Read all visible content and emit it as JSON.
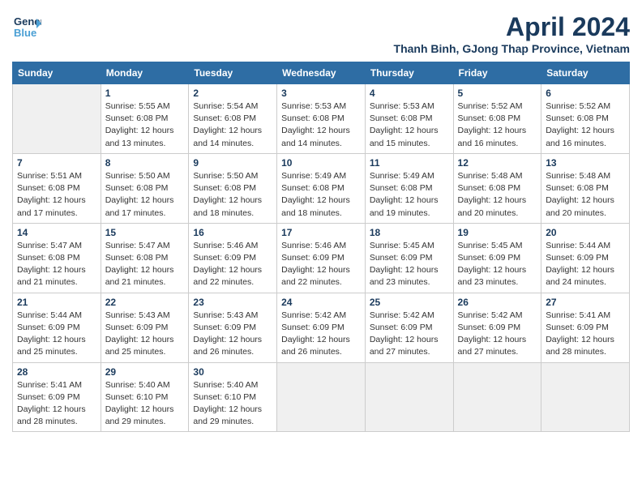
{
  "header": {
    "logo_line1": "General",
    "logo_line2": "Blue",
    "title": "April 2024",
    "subtitle": "Thanh Binh, GJong Thap Province, Vietnam"
  },
  "weekdays": [
    "Sunday",
    "Monday",
    "Tuesday",
    "Wednesday",
    "Thursday",
    "Friday",
    "Saturday"
  ],
  "weeks": [
    [
      {
        "day": "",
        "empty": true
      },
      {
        "day": "1",
        "sunrise": "5:55 AM",
        "sunset": "6:08 PM",
        "daylight": "12 hours and 13 minutes."
      },
      {
        "day": "2",
        "sunrise": "5:54 AM",
        "sunset": "6:08 PM",
        "daylight": "12 hours and 14 minutes."
      },
      {
        "day": "3",
        "sunrise": "5:53 AM",
        "sunset": "6:08 PM",
        "daylight": "12 hours and 14 minutes."
      },
      {
        "day": "4",
        "sunrise": "5:53 AM",
        "sunset": "6:08 PM",
        "daylight": "12 hours and 15 minutes."
      },
      {
        "day": "5",
        "sunrise": "5:52 AM",
        "sunset": "6:08 PM",
        "daylight": "12 hours and 16 minutes."
      },
      {
        "day": "6",
        "sunrise": "5:52 AM",
        "sunset": "6:08 PM",
        "daylight": "12 hours and 16 minutes."
      }
    ],
    [
      {
        "day": "7",
        "sunrise": "5:51 AM",
        "sunset": "6:08 PM",
        "daylight": "12 hours and 17 minutes."
      },
      {
        "day": "8",
        "sunrise": "5:50 AM",
        "sunset": "6:08 PM",
        "daylight": "12 hours and 17 minutes."
      },
      {
        "day": "9",
        "sunrise": "5:50 AM",
        "sunset": "6:08 PM",
        "daylight": "12 hours and 18 minutes."
      },
      {
        "day": "10",
        "sunrise": "5:49 AM",
        "sunset": "6:08 PM",
        "daylight": "12 hours and 18 minutes."
      },
      {
        "day": "11",
        "sunrise": "5:49 AM",
        "sunset": "6:08 PM",
        "daylight": "12 hours and 19 minutes."
      },
      {
        "day": "12",
        "sunrise": "5:48 AM",
        "sunset": "6:08 PM",
        "daylight": "12 hours and 20 minutes."
      },
      {
        "day": "13",
        "sunrise": "5:48 AM",
        "sunset": "6:08 PM",
        "daylight": "12 hours and 20 minutes."
      }
    ],
    [
      {
        "day": "14",
        "sunrise": "5:47 AM",
        "sunset": "6:08 PM",
        "daylight": "12 hours and 21 minutes."
      },
      {
        "day": "15",
        "sunrise": "5:47 AM",
        "sunset": "6:08 PM",
        "daylight": "12 hours and 21 minutes."
      },
      {
        "day": "16",
        "sunrise": "5:46 AM",
        "sunset": "6:09 PM",
        "daylight": "12 hours and 22 minutes."
      },
      {
        "day": "17",
        "sunrise": "5:46 AM",
        "sunset": "6:09 PM",
        "daylight": "12 hours and 22 minutes."
      },
      {
        "day": "18",
        "sunrise": "5:45 AM",
        "sunset": "6:09 PM",
        "daylight": "12 hours and 23 minutes."
      },
      {
        "day": "19",
        "sunrise": "5:45 AM",
        "sunset": "6:09 PM",
        "daylight": "12 hours and 23 minutes."
      },
      {
        "day": "20",
        "sunrise": "5:44 AM",
        "sunset": "6:09 PM",
        "daylight": "12 hours and 24 minutes."
      }
    ],
    [
      {
        "day": "21",
        "sunrise": "5:44 AM",
        "sunset": "6:09 PM",
        "daylight": "12 hours and 25 minutes."
      },
      {
        "day": "22",
        "sunrise": "5:43 AM",
        "sunset": "6:09 PM",
        "daylight": "12 hours and 25 minutes."
      },
      {
        "day": "23",
        "sunrise": "5:43 AM",
        "sunset": "6:09 PM",
        "daylight": "12 hours and 26 minutes."
      },
      {
        "day": "24",
        "sunrise": "5:42 AM",
        "sunset": "6:09 PM",
        "daylight": "12 hours and 26 minutes."
      },
      {
        "day": "25",
        "sunrise": "5:42 AM",
        "sunset": "6:09 PM",
        "daylight": "12 hours and 27 minutes."
      },
      {
        "day": "26",
        "sunrise": "5:42 AM",
        "sunset": "6:09 PM",
        "daylight": "12 hours and 27 minutes."
      },
      {
        "day": "27",
        "sunrise": "5:41 AM",
        "sunset": "6:09 PM",
        "daylight": "12 hours and 28 minutes."
      }
    ],
    [
      {
        "day": "28",
        "sunrise": "5:41 AM",
        "sunset": "6:09 PM",
        "daylight": "12 hours and 28 minutes."
      },
      {
        "day": "29",
        "sunrise": "5:40 AM",
        "sunset": "6:10 PM",
        "daylight": "12 hours and 29 minutes."
      },
      {
        "day": "30",
        "sunrise": "5:40 AM",
        "sunset": "6:10 PM",
        "daylight": "12 hours and 29 minutes."
      },
      {
        "day": "",
        "empty": true
      },
      {
        "day": "",
        "empty": true
      },
      {
        "day": "",
        "empty": true
      },
      {
        "day": "",
        "empty": true
      }
    ]
  ]
}
